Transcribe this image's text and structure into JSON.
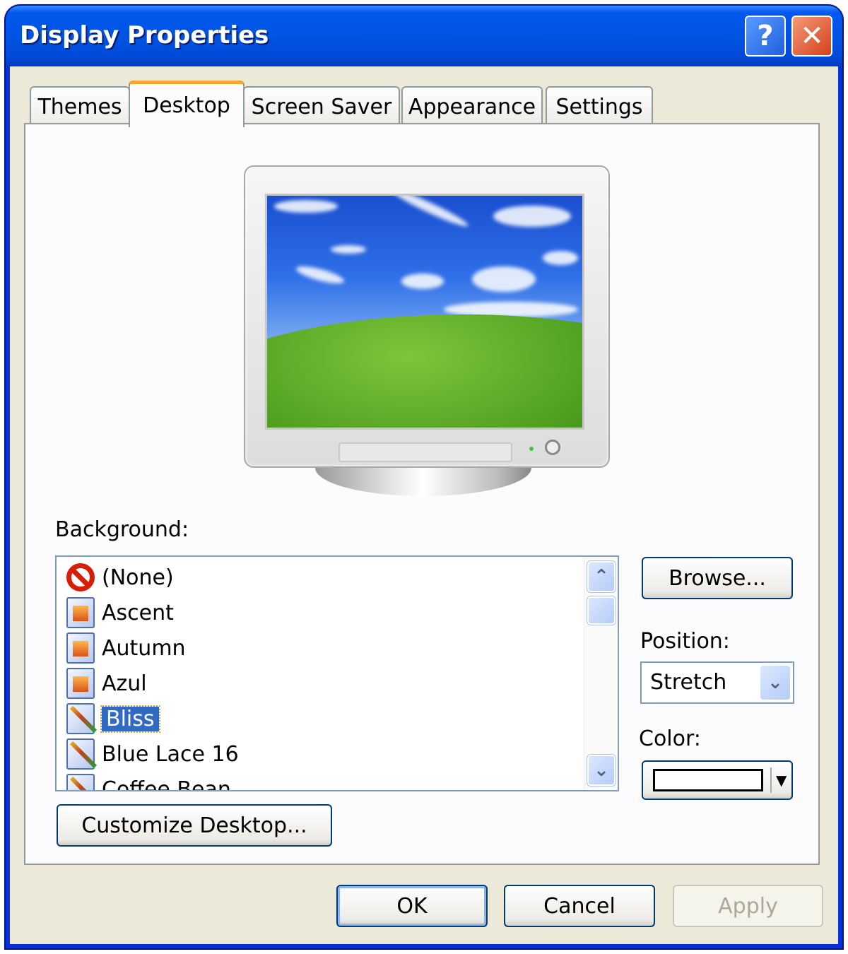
{
  "window": {
    "title": "Display Properties",
    "help_label": "?",
    "close_label": "✕"
  },
  "tabs": [
    {
      "label": "Themes",
      "active": false
    },
    {
      "label": "Desktop",
      "active": true
    },
    {
      "label": "Screen Saver",
      "active": false
    },
    {
      "label": "Appearance",
      "active": false
    },
    {
      "label": "Settings",
      "active": false
    }
  ],
  "desktop": {
    "preview_wallpaper": "Bliss",
    "background_label": "Background:",
    "backgrounds": [
      {
        "label": "(None)",
        "icon": "no-entry-icon"
      },
      {
        "label": "Ascent",
        "icon": "image-file-icon"
      },
      {
        "label": "Autumn",
        "icon": "image-file-icon"
      },
      {
        "label": "Azul",
        "icon": "image-file-icon"
      },
      {
        "label": "Bliss",
        "icon": "paint-file-icon",
        "selected": true
      },
      {
        "label": "Blue Lace 16",
        "icon": "paint-file-icon"
      },
      {
        "label": "Coffee Bean",
        "icon": "paint-file-icon"
      }
    ],
    "browse_label": "Browse...",
    "position_label": "Position:",
    "position_value": "Stretch",
    "color_label": "Color:",
    "color_value": "#ffffff",
    "customize_label": "Customize Desktop..."
  },
  "footer": {
    "ok": "OK",
    "cancel": "Cancel",
    "apply": "Apply",
    "apply_enabled": false
  },
  "colors": {
    "titlebar": "#0054e3",
    "dialog": "#ece9d8",
    "selection": "#316ac5",
    "active_tab_accent": "#f2a531"
  }
}
